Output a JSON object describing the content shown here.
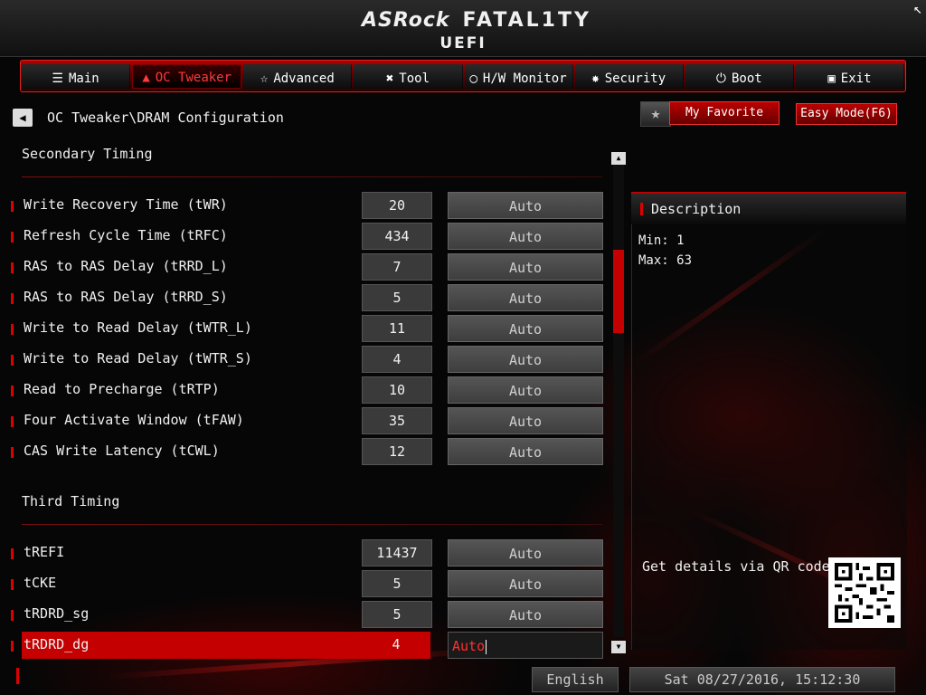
{
  "brand": {
    "left": "ASRock",
    "right": "FATAL1TY",
    "sub": "UEFI"
  },
  "tabs": [
    {
      "label": "Main",
      "icon": "list-icon",
      "active": false
    },
    {
      "label": "OC Tweaker",
      "icon": "flame-icon",
      "active": true
    },
    {
      "label": "Advanced",
      "icon": "star-advanced-icon",
      "active": false
    },
    {
      "label": "Tool",
      "icon": "tools-icon",
      "active": false
    },
    {
      "label": "H/W Monitor",
      "icon": "monitor-icon",
      "active": false
    },
    {
      "label": "Security",
      "icon": "shield-icon",
      "active": false
    },
    {
      "label": "Boot",
      "icon": "power-icon",
      "active": false
    },
    {
      "label": "Exit",
      "icon": "exit-icon",
      "active": false
    }
  ],
  "breadcrumb": "OC Tweaker\\DRAM Configuration",
  "my_favorite": "My Favorite",
  "easy_mode": "Easy Mode(F6)",
  "sections": {
    "secondary": "Secondary Timing",
    "third": "Third Timing"
  },
  "secondary_rows": [
    {
      "label": "Write Recovery Time (tWR)",
      "value": "20",
      "mode": "Auto"
    },
    {
      "label": "Refresh Cycle Time (tRFC)",
      "value": "434",
      "mode": "Auto"
    },
    {
      "label": "RAS to RAS Delay (tRRD_L)",
      "value": "7",
      "mode": "Auto"
    },
    {
      "label": "RAS to RAS Delay (tRRD_S)",
      "value": "5",
      "mode": "Auto"
    },
    {
      "label": "Write to Read Delay (tWTR_L)",
      "value": "11",
      "mode": "Auto"
    },
    {
      "label": "Write to Read Delay (tWTR_S)",
      "value": "4",
      "mode": "Auto"
    },
    {
      "label": "Read to Precharge (tRTP)",
      "value": "10",
      "mode": "Auto"
    },
    {
      "label": "Four Activate Window (tFAW)",
      "value": "35",
      "mode": "Auto"
    },
    {
      "label": "CAS Write Latency (tCWL)",
      "value": "12",
      "mode": "Auto"
    }
  ],
  "third_rows": [
    {
      "label": "tREFI",
      "value": "11437",
      "mode": "Auto"
    },
    {
      "label": "tCKE",
      "value": "5",
      "mode": "Auto"
    },
    {
      "label": "tRDRD_sg",
      "value": "5",
      "mode": "Auto"
    },
    {
      "label": "tRDRD_dg",
      "value": "4",
      "mode": "Auto",
      "selected": true
    }
  ],
  "description": {
    "title": "Description",
    "min": "Min: 1",
    "max": "Max: 63",
    "qr_text": "Get details via QR code"
  },
  "footer": {
    "language": "English",
    "datetime": "Sat 08/27/2016, 15:12:30"
  },
  "colors": {
    "accent": "#c40000",
    "background": "#050505"
  }
}
